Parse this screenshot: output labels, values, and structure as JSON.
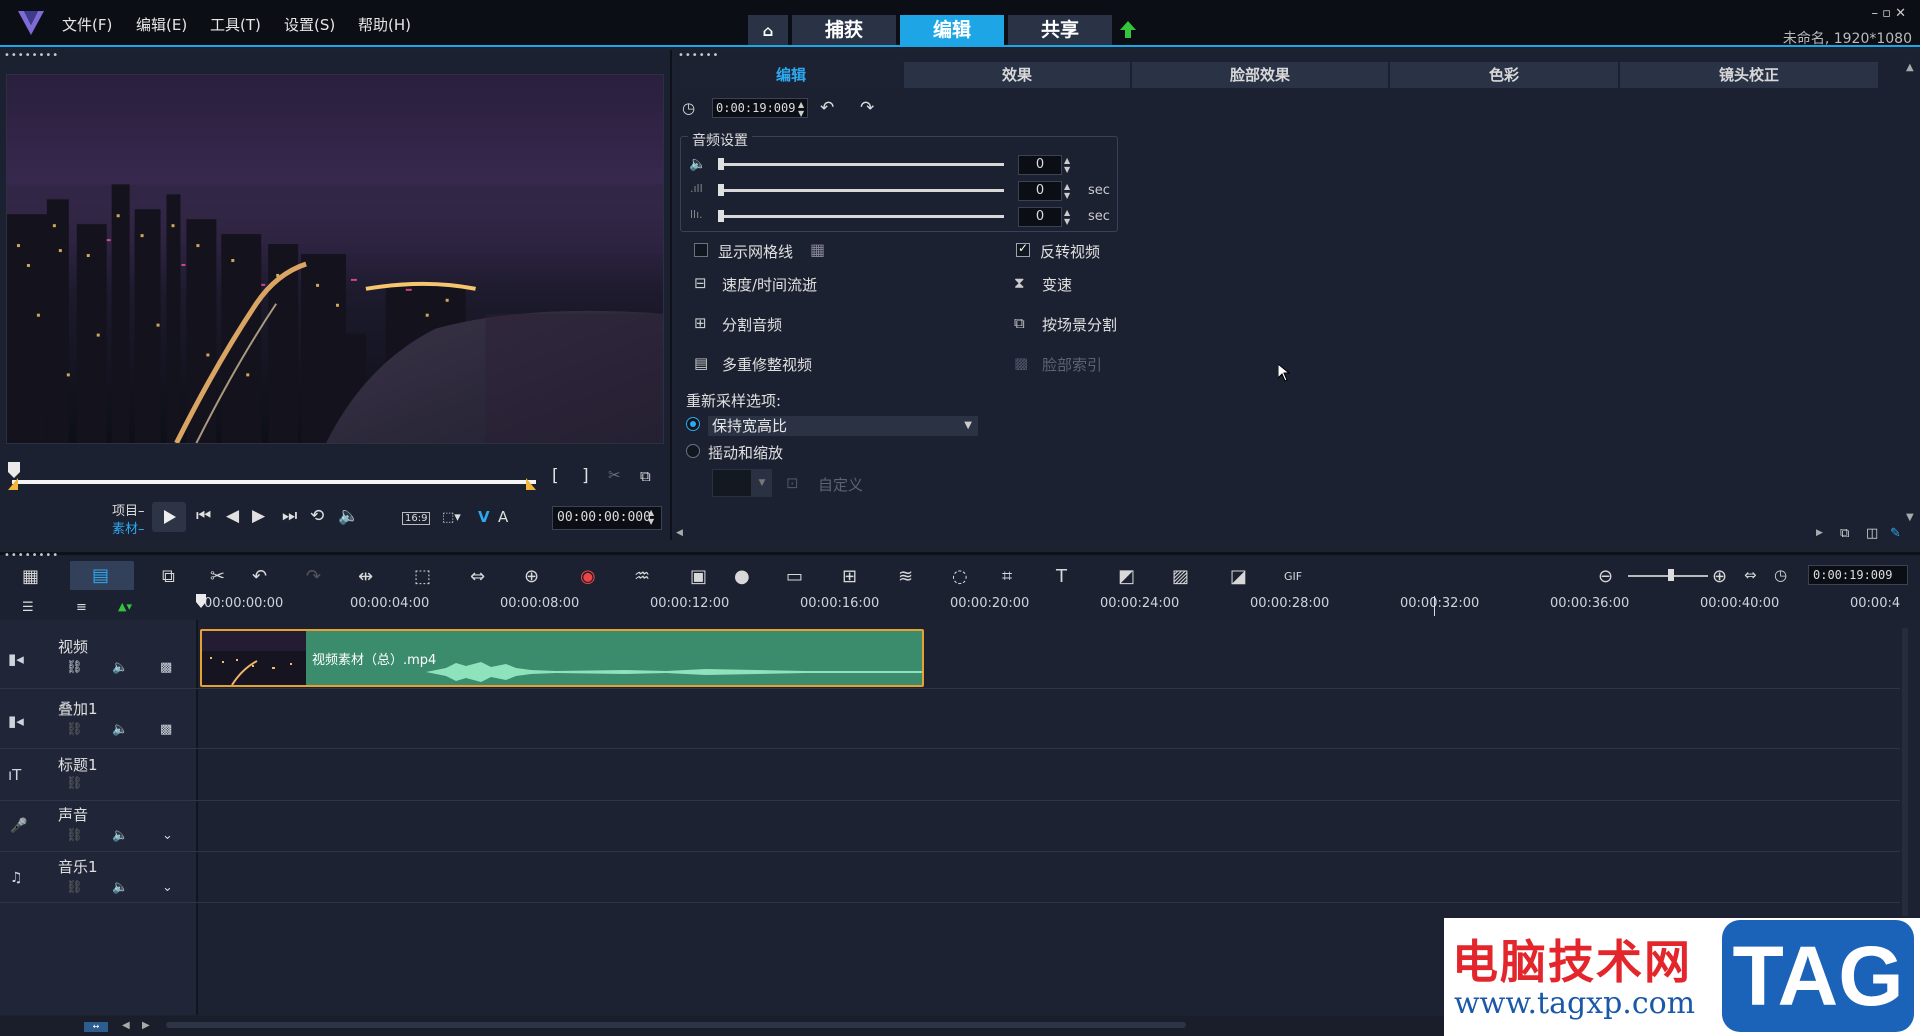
{
  "menu": [
    "文件(F)",
    "编辑(E)",
    "工具(T)",
    "设置(S)",
    "帮助(H)"
  ],
  "modes": {
    "capture": "捕获",
    "edit": "编辑",
    "share": "共享"
  },
  "window_controls": "– ▫ ✕",
  "project_info": "未命名, 1920*1080",
  "player": {
    "project_label": "项目–",
    "clip_label": "素材–",
    "timecode": "00:00:00:000",
    "aspect": "16:9"
  },
  "options": {
    "tabs": [
      "编辑",
      "效果",
      "脸部效果",
      "色彩",
      "镜头校正"
    ],
    "duration": "0:00:19:009",
    "audio_settings": "音频设置",
    "volume": "0",
    "fade_in": "0",
    "fade_out": "0",
    "sec": "sec",
    "show_grid": "显示网格线",
    "reverse_video": "反转视频",
    "speed_time_lapse": "速度/时间流逝",
    "variable_speed": "变速",
    "split_audio": "分割音频",
    "split_by_scene": "按场景分割",
    "multi_trim": "多重修整视频",
    "face_index": "脸部索引",
    "resample_label": "重新采样选项:",
    "keep_aspect": "保持宽高比",
    "pan_zoom": "摇动和缩放",
    "custom": "自定义"
  },
  "timeline": {
    "zoom_timecode": "0:00:19:009",
    "ticks": [
      "00:00:00:00",
      "00:00:04:00",
      "00:00:08:00",
      "00:00:12:00",
      "00:00:16:00",
      "00:00:20:00",
      "00:00:24:00",
      "00:00:28:00",
      "00:00:32:00",
      "00:00:36:00",
      "00:00:40:00",
      "00:00:4"
    ],
    "tracks": [
      "视频",
      "叠加1",
      "标题1",
      "声音",
      "音乐1"
    ],
    "clip_name": "视频素材（总）.mp4"
  },
  "watermark": {
    "title": "电脑技术网",
    "url": "www.tagxp.com",
    "tag": "TAG"
  },
  "colors": {
    "accent": "#1ea5e6",
    "clip": "#3b8c6c",
    "clip_border": "#e5a131"
  }
}
